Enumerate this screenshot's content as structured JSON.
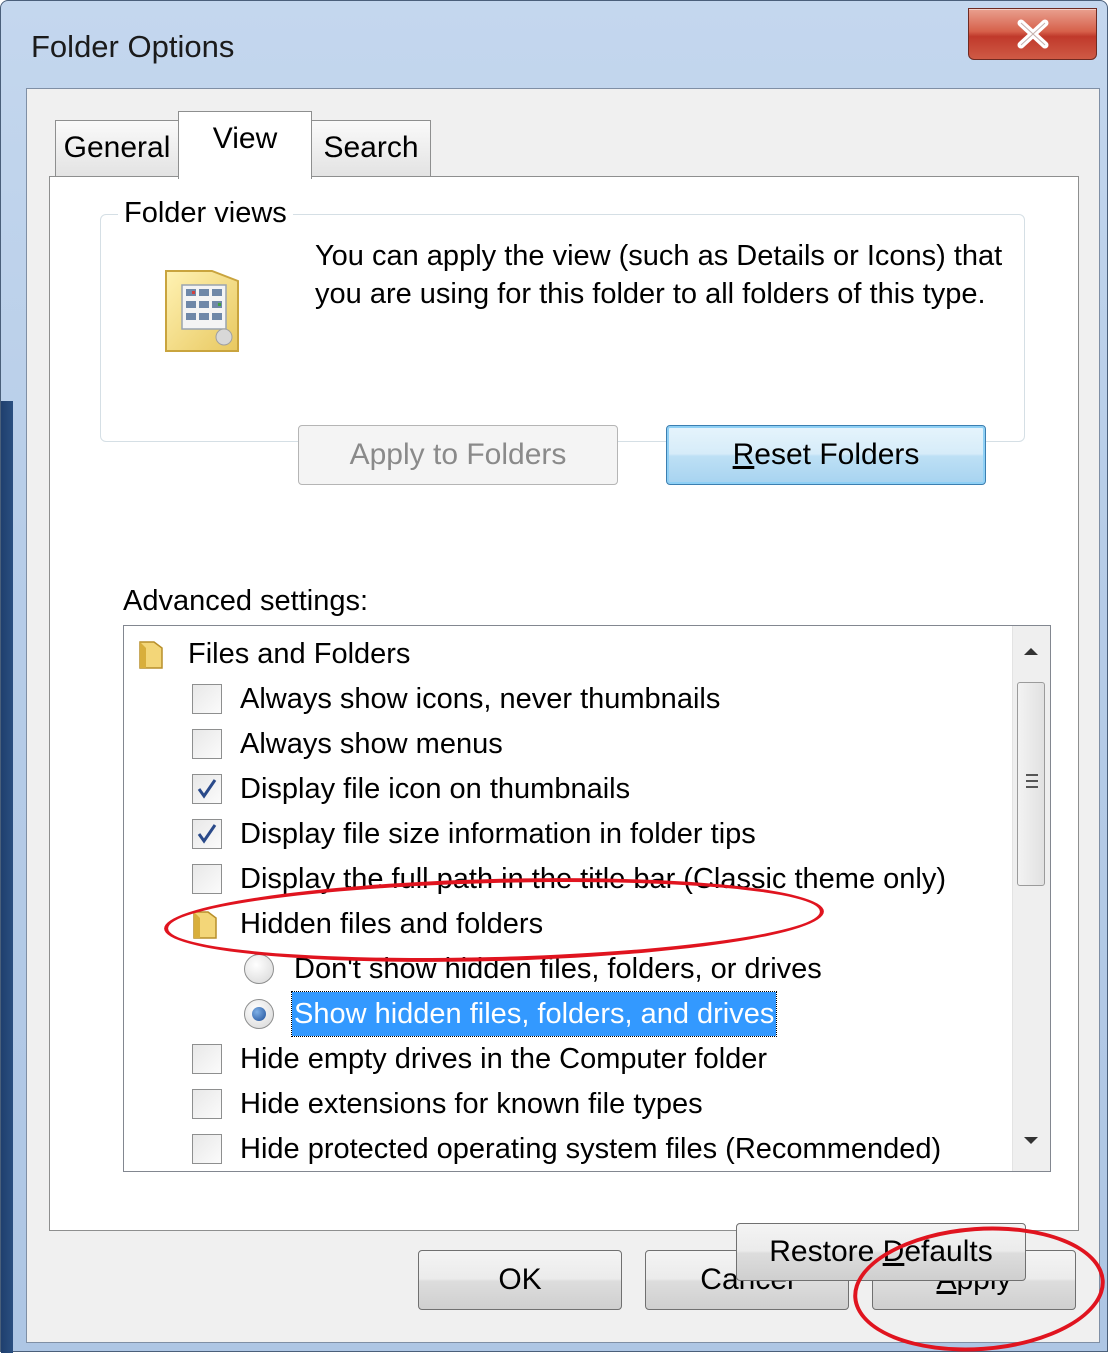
{
  "window": {
    "title": "Folder Options",
    "close_glyph": "X"
  },
  "tabs": [
    {
      "label": "General",
      "active": false
    },
    {
      "label": "View",
      "active": true
    },
    {
      "label": "Search",
      "active": false
    }
  ],
  "folder_views": {
    "label": "Folder views",
    "description": "You can apply the view (such as Details or Icons) that you are using for this folder to all folders of this type.",
    "apply_button": "Apply to Folders",
    "reset_button_prefix": "R",
    "reset_button_rest": "eset Folders",
    "icon": "folder-view-icon"
  },
  "advanced": {
    "label": "Advanced settings:",
    "items": [
      {
        "type": "group",
        "label": "Files and Folders",
        "icon": "folder-icon"
      },
      {
        "type": "checkbox",
        "label": "Always show icons, never thumbnails",
        "checked": false
      },
      {
        "type": "checkbox",
        "label": "Always show menus",
        "checked": false
      },
      {
        "type": "checkbox",
        "label": "Display file icon on thumbnails",
        "checked": true
      },
      {
        "type": "checkbox",
        "label": "Display file size information in folder tips",
        "checked": true
      },
      {
        "type": "checkbox",
        "label": "Display the full path in the title bar (Classic theme only)",
        "checked": false
      },
      {
        "type": "group",
        "label": "Hidden files and folders",
        "icon": "folder-icon"
      },
      {
        "type": "radio",
        "label": "Don't show hidden files, folders, or drives",
        "checked": false
      },
      {
        "type": "radio",
        "label": "Show hidden files, folders, and drives",
        "checked": true,
        "selected": true
      },
      {
        "type": "checkbox",
        "label": "Hide empty drives in the Computer folder",
        "checked": false
      },
      {
        "type": "checkbox",
        "label": "Hide extensions for known file types",
        "checked": false
      },
      {
        "type": "checkbox",
        "label": "Hide protected operating system files (Recommended)",
        "checked": false
      }
    ]
  },
  "restore_defaults": {
    "prefix": "Restore ",
    "mnemonic": "D",
    "rest": "efaults"
  },
  "buttons": {
    "ok": "OK",
    "cancel": "Cancel",
    "apply_mnemonic": "A",
    "apply_rest": "pply"
  },
  "colors": {
    "selection": "#3399ff",
    "annotation": "#e0141f",
    "default_button": "#bde0f5"
  }
}
